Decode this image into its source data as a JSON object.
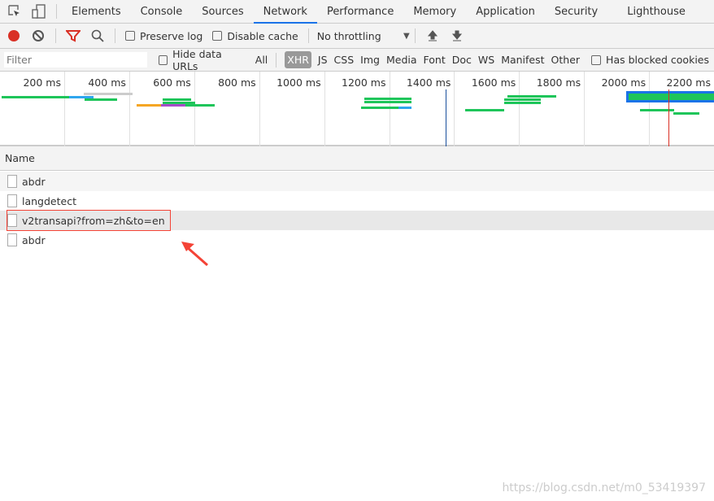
{
  "tabs": [
    "Elements",
    "Console",
    "Sources",
    "Network",
    "Performance",
    "Memory",
    "Application",
    "Security",
    "Lighthouse"
  ],
  "active_tab": "Network",
  "toolbar": {
    "preserve_log": "Preserve log",
    "disable_cache": "Disable cache",
    "throttling": "No throttling"
  },
  "filter": {
    "placeholder": "Filter",
    "hide_data_urls": "Hide data URLs",
    "types": [
      "All",
      "XHR",
      "JS",
      "CSS",
      "Img",
      "Media",
      "Font",
      "Doc",
      "WS",
      "Manifest",
      "Other"
    ],
    "active_type": "XHR",
    "has_blocked": "Has blocked cookies"
  },
  "overview": {
    "ticks": [
      "200 ms",
      "400 ms",
      "600 ms",
      "800 ms",
      "1000 ms",
      "1200 ms",
      "1400 ms",
      "1600 ms",
      "1800 ms",
      "2000 ms",
      "2200 ms"
    ]
  },
  "table": {
    "column": "Name",
    "rows": [
      "abdr",
      "langdetect",
      "v2transapi?from=zh&to=en",
      "abdr"
    ],
    "selected": 2
  },
  "colors": {
    "accent": "#1a73e8",
    "record": "#d93025",
    "highlight": "#f44336",
    "bar_green": "#1ec55a",
    "bar_blue": "#2fa6ee"
  },
  "watermark": "https://blog.csdn.net/m0_53419397"
}
